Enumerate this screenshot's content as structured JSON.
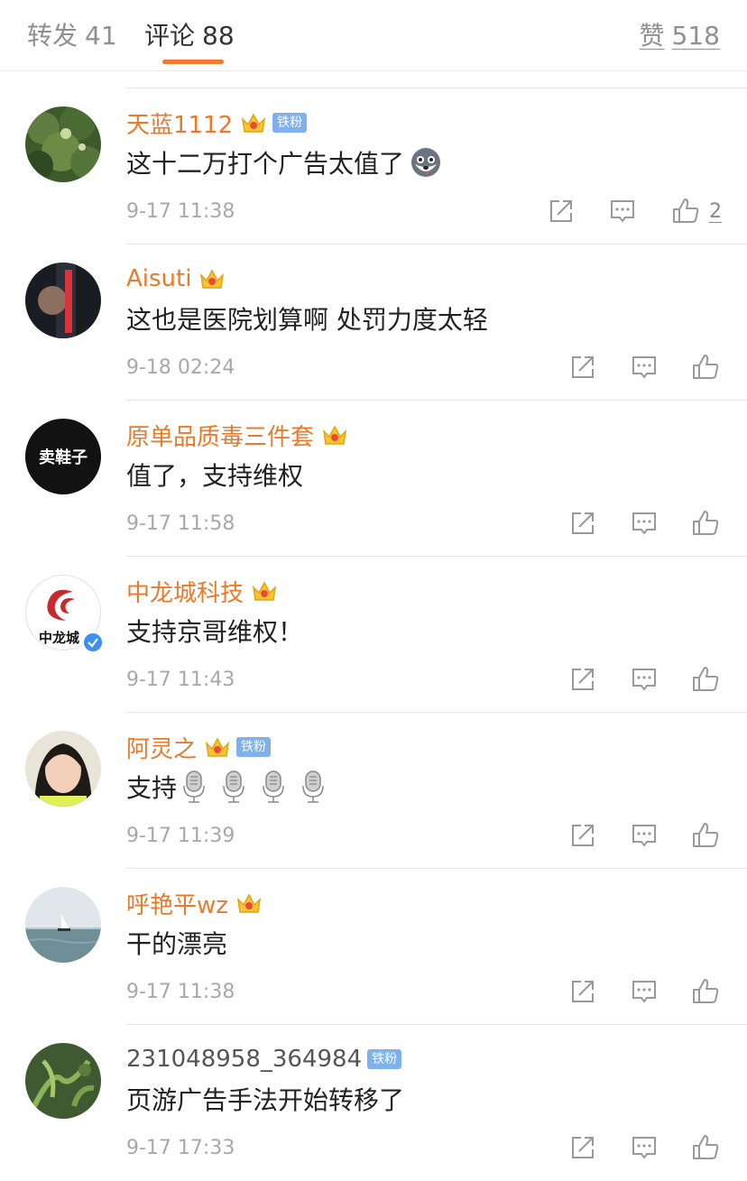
{
  "tabs": {
    "repost": {
      "label": "转发",
      "count": "41"
    },
    "comments": {
      "label": "评论",
      "count": "88"
    },
    "likes": {
      "label": "赞",
      "count": "518"
    }
  },
  "colors": {
    "accent": "#f3792e",
    "username": "#ea7a2a",
    "badge": "#7fb1ed",
    "meta": "#a8a8a8"
  },
  "comments": [
    {
      "user": "天蓝1112",
      "crown": true,
      "badge": "铁粉",
      "text": "这十二万打个广告太值了",
      "emoji": "husky-emoji",
      "time": "9-17 11:38",
      "likes": "2"
    },
    {
      "user": "Aisuti",
      "crown": true,
      "badge": "",
      "text": "这也是医院划算啊 处罚力度太轻",
      "time": "9-18 02:24",
      "likes": ""
    },
    {
      "user": "原单品质毒三件套",
      "crown": true,
      "badge": "",
      "text": "值了，支持维权",
      "time": "9-17 11:58",
      "likes": "",
      "avatar_text": "卖鞋子"
    },
    {
      "user": "中龙城科技",
      "crown": true,
      "badge": "",
      "text": "支持京哥维权！",
      "time": "9-17 11:43",
      "likes": "",
      "avatar_text": "中龙城",
      "verified": true
    },
    {
      "user": "阿灵之",
      "crown": true,
      "badge": "铁粉",
      "text": "支持",
      "emoji": "microphone-emoji x4",
      "time": "9-17 11:39",
      "likes": ""
    },
    {
      "user": "呼艳平wz",
      "crown": true,
      "badge": "",
      "text": "干的漂亮",
      "time": "9-17 11:38",
      "likes": ""
    },
    {
      "user": "231048958_364984",
      "crown": false,
      "badge": "铁粉",
      "text": "页游广告手法开始转移了",
      "time": "9-17 17:33",
      "likes": ""
    }
  ]
}
